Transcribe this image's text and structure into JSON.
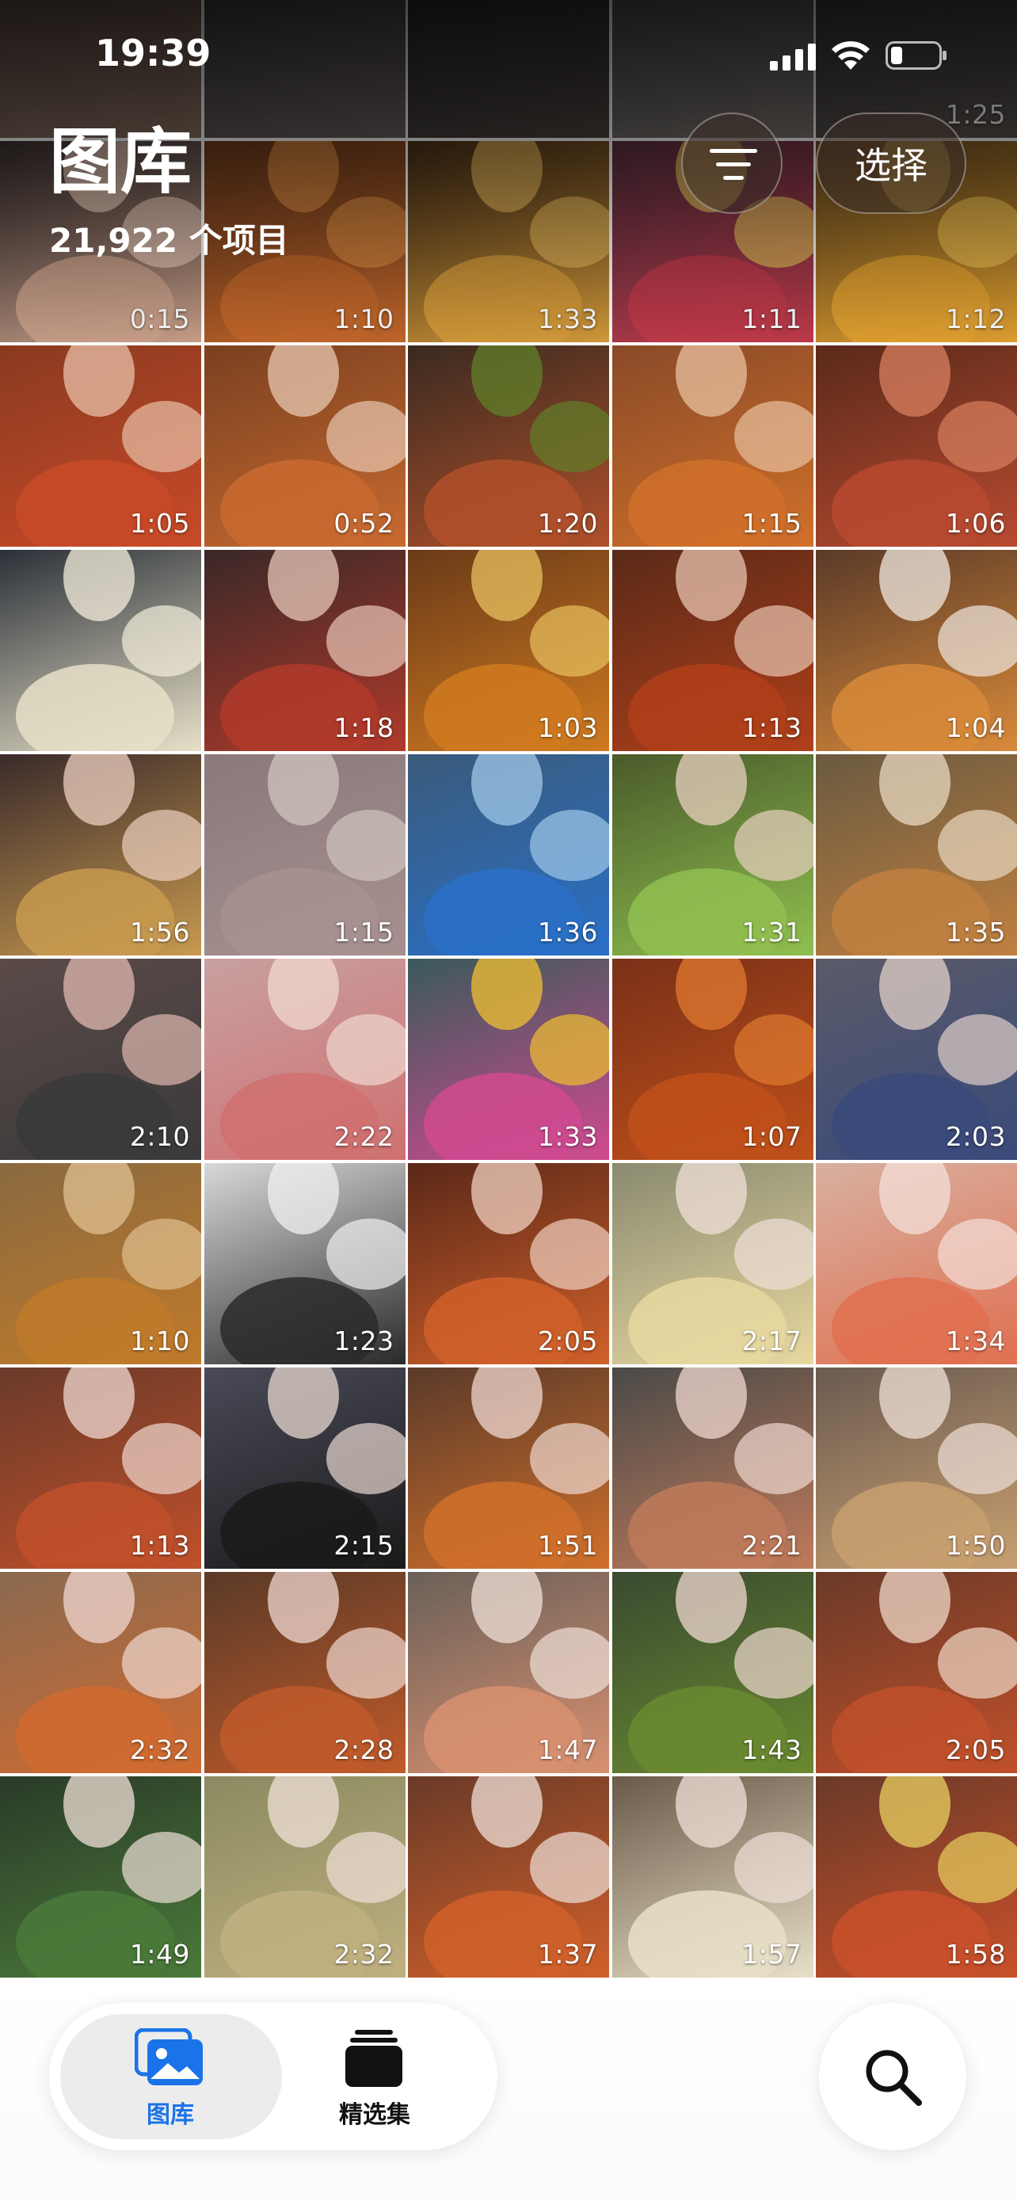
{
  "status_bar": {
    "time": "19:39",
    "icons": [
      "cellular-signal-icon",
      "wifi-icon",
      "battery-icon"
    ]
  },
  "header": {
    "title": "图库",
    "item_count": "21,922 个项目",
    "filter_icon": "filter-lines-icon",
    "select_label": "选择"
  },
  "grid": {
    "tiles": [
      {
        "duration": "0:15",
        "c1": "#3a3030",
        "c2": "#c9a08a",
        "c3": "#e8c9b8"
      },
      {
        "duration": "1:10",
        "c1": "#6b3a1c",
        "c2": "#c2662a",
        "c3": "#d98a40"
      },
      {
        "duration": "1:33",
        "c1": "#4a3018",
        "c2": "#d39a3a",
        "c3": "#e6b65a"
      },
      {
        "duration": "1:11",
        "c1": "#5a3040",
        "c2": "#c03a4a",
        "c3": "#e6c05a"
      },
      {
        "duration": "1:12",
        "c1": "#6a4a20",
        "c2": "#e0a030",
        "c3": "#f0c050"
      },
      {
        "duration": "1:05",
        "c1": "#8a3a20",
        "c2": "#c84a28",
        "c3": "#e8c0a8"
      },
      {
        "duration": "0:52",
        "c1": "#7a4020",
        "c2": "#c86a30",
        "c3": "#e8c8b0"
      },
      {
        "duration": "1:20",
        "c1": "#3a2a20",
        "c2": "#b0502a",
        "c3": "#60802a"
      },
      {
        "duration": "1:15",
        "c1": "#8a4a28",
        "c2": "#d0702a",
        "c3": "#e8c0a0"
      },
      {
        "duration": "1:06",
        "c1": "#5a2a1a",
        "c2": "#b84a30",
        "c3": "#d88060"
      },
      {
        "duration": "",
        "c1": "#2a3038",
        "c2": "#e8e0c8",
        "c3": "#f4eedc"
      },
      {
        "duration": "1:18",
        "c1": "#3a2828",
        "c2": "#b03a2a",
        "c3": "#e8c8b8"
      },
      {
        "duration": "1:03",
        "c1": "#6a3a18",
        "c2": "#d07a20",
        "c3": "#e8c060"
      },
      {
        "duration": "1:13",
        "c1": "#5a2a18",
        "c2": "#b0401a",
        "c3": "#e8c4b0"
      },
      {
        "duration": "1:04",
        "c1": "#5a3a28",
        "c2": "#d88a3a",
        "c3": "#f0e8e0"
      },
      {
        "duration": "1:56",
        "c1": "#3a2a2a",
        "c2": "#c89a50",
        "c3": "#ecd0c0"
      },
      {
        "duration": "1:15",
        "c1": "#8a7a7a",
        "c2": "#a89090",
        "c3": "#d0c4c0"
      },
      {
        "duration": "1:36",
        "c1": "#3a5a7a",
        "c2": "#2a70c8",
        "c3": "#a0c8e8"
      },
      {
        "duration": "1:31",
        "c1": "#4a5a2a",
        "c2": "#90c050",
        "c3": "#e8d0c0"
      },
      {
        "duration": "1:35",
        "c1": "#6a5a40",
        "c2": "#c08040",
        "c3": "#e8d8c0"
      },
      {
        "duration": "2:10",
        "c1": "#5a4a48",
        "c2": "#3a3a3a",
        "c3": "#e0b8b0"
      },
      {
        "duration": "2:22",
        "c1": "#c8a0a0",
        "c2": "#d07070",
        "c3": "#f0d8d0"
      },
      {
        "duration": "1:33",
        "c1": "#3a5a5a",
        "c2": "#d04a90",
        "c3": "#f0c030"
      },
      {
        "duration": "1:07",
        "c1": "#7a3018",
        "c2": "#c0501a",
        "c3": "#e07a30"
      },
      {
        "duration": "2:03",
        "c1": "#5a5a68",
        "c2": "#3a4a7a",
        "c3": "#e0d0c8"
      },
      {
        "duration": "1:10",
        "c1": "#8a6a40",
        "c2": "#c07a2a",
        "c3": "#e0c090"
      },
      {
        "duration": "1:23",
        "c1": "#d8d8d8",
        "c2": "#2a2a2a",
        "c3": "#f0f0f0"
      },
      {
        "duration": "2:05",
        "c1": "#5a2818",
        "c2": "#d0602a",
        "c3": "#f0d0c0"
      },
      {
        "duration": "2:17",
        "c1": "#8a8a70",
        "c2": "#e8d8a0",
        "c3": "#f0e0d8"
      },
      {
        "duration": "1:34",
        "c1": "#d8b0a0",
        "c2": "#e07050",
        "c3": "#f4e0d8"
      },
      {
        "duration": "1:13",
        "c1": "#6a3a2a",
        "c2": "#c0502a",
        "c3": "#f0d8d0"
      },
      {
        "duration": "2:15",
        "c1": "#4a4a58",
        "c2": "#1a1a1a",
        "c3": "#e8d8d0"
      },
      {
        "duration": "1:51",
        "c1": "#5a3a2a",
        "c2": "#d0702a",
        "c3": "#f0d8d0"
      },
      {
        "duration": "2:21",
        "c1": "#4a4a48",
        "c2": "#c07a5a",
        "c3": "#f0d8d0"
      },
      {
        "duration": "1:50",
        "c1": "#6a5a50",
        "c2": "#c8a070",
        "c3": "#f0e0d8"
      },
      {
        "duration": "2:32",
        "c1": "#8a6a50",
        "c2": "#d06a30",
        "c3": "#f0d8d0"
      },
      {
        "duration": "2:28",
        "c1": "#5a3a28",
        "c2": "#c05a2a",
        "c3": "#f0d8d0"
      },
      {
        "duration": "1:47",
        "c1": "#6a6058",
        "c2": "#d89070",
        "c3": "#f0e0d8"
      },
      {
        "duration": "1:43",
        "c1": "#3a4a30",
        "c2": "#6a8a30",
        "c3": "#f0d8d0"
      },
      {
        "duration": "2:05",
        "c1": "#6a3a28",
        "c2": "#c0502a",
        "c3": "#f0d8c8"
      },
      {
        "duration": "1:49",
        "c1": "#2a3a28",
        "c2": "#4a7a3a",
        "c3": "#f0e0d8"
      },
      {
        "duration": "2:32",
        "c1": "#8a8a60",
        "c2": "#c0b080",
        "c3": "#f0e0d8"
      },
      {
        "duration": "1:37",
        "c1": "#6a3a28",
        "c2": "#d0602a",
        "c3": "#f0e0d8"
      },
      {
        "duration": "1:57",
        "c1": "#6a5a48",
        "c2": "#e8e0c8",
        "c3": "#f0e0d8"
      },
      {
        "duration": "1:58",
        "c1": "#6a3a28",
        "c2": "#c8502a",
        "c3": "#e8d060"
      }
    ],
    "top_row": [
      {
        "c1": "#5a4a48",
        "c2": "#8a7060"
      },
      {
        "c1": "#3a3838",
        "c2": "#6a6060"
      },
      {
        "c1": "#2a2828",
        "c2": "#4a4440"
      },
      {
        "c1": "#4a4a48",
        "c2": "#7a7470"
      },
      {
        "c1": "#3a3838",
        "c2": "#5a5450"
      }
    ],
    "top_row_duration": "1:25"
  },
  "tab_bar": {
    "library_label": "图库",
    "library_icon": "photo-library-icon",
    "collections_label": "精选集",
    "collections_icon": "stack-collections-icon",
    "search_icon": "search-icon",
    "active_color": "#1a73e8"
  }
}
